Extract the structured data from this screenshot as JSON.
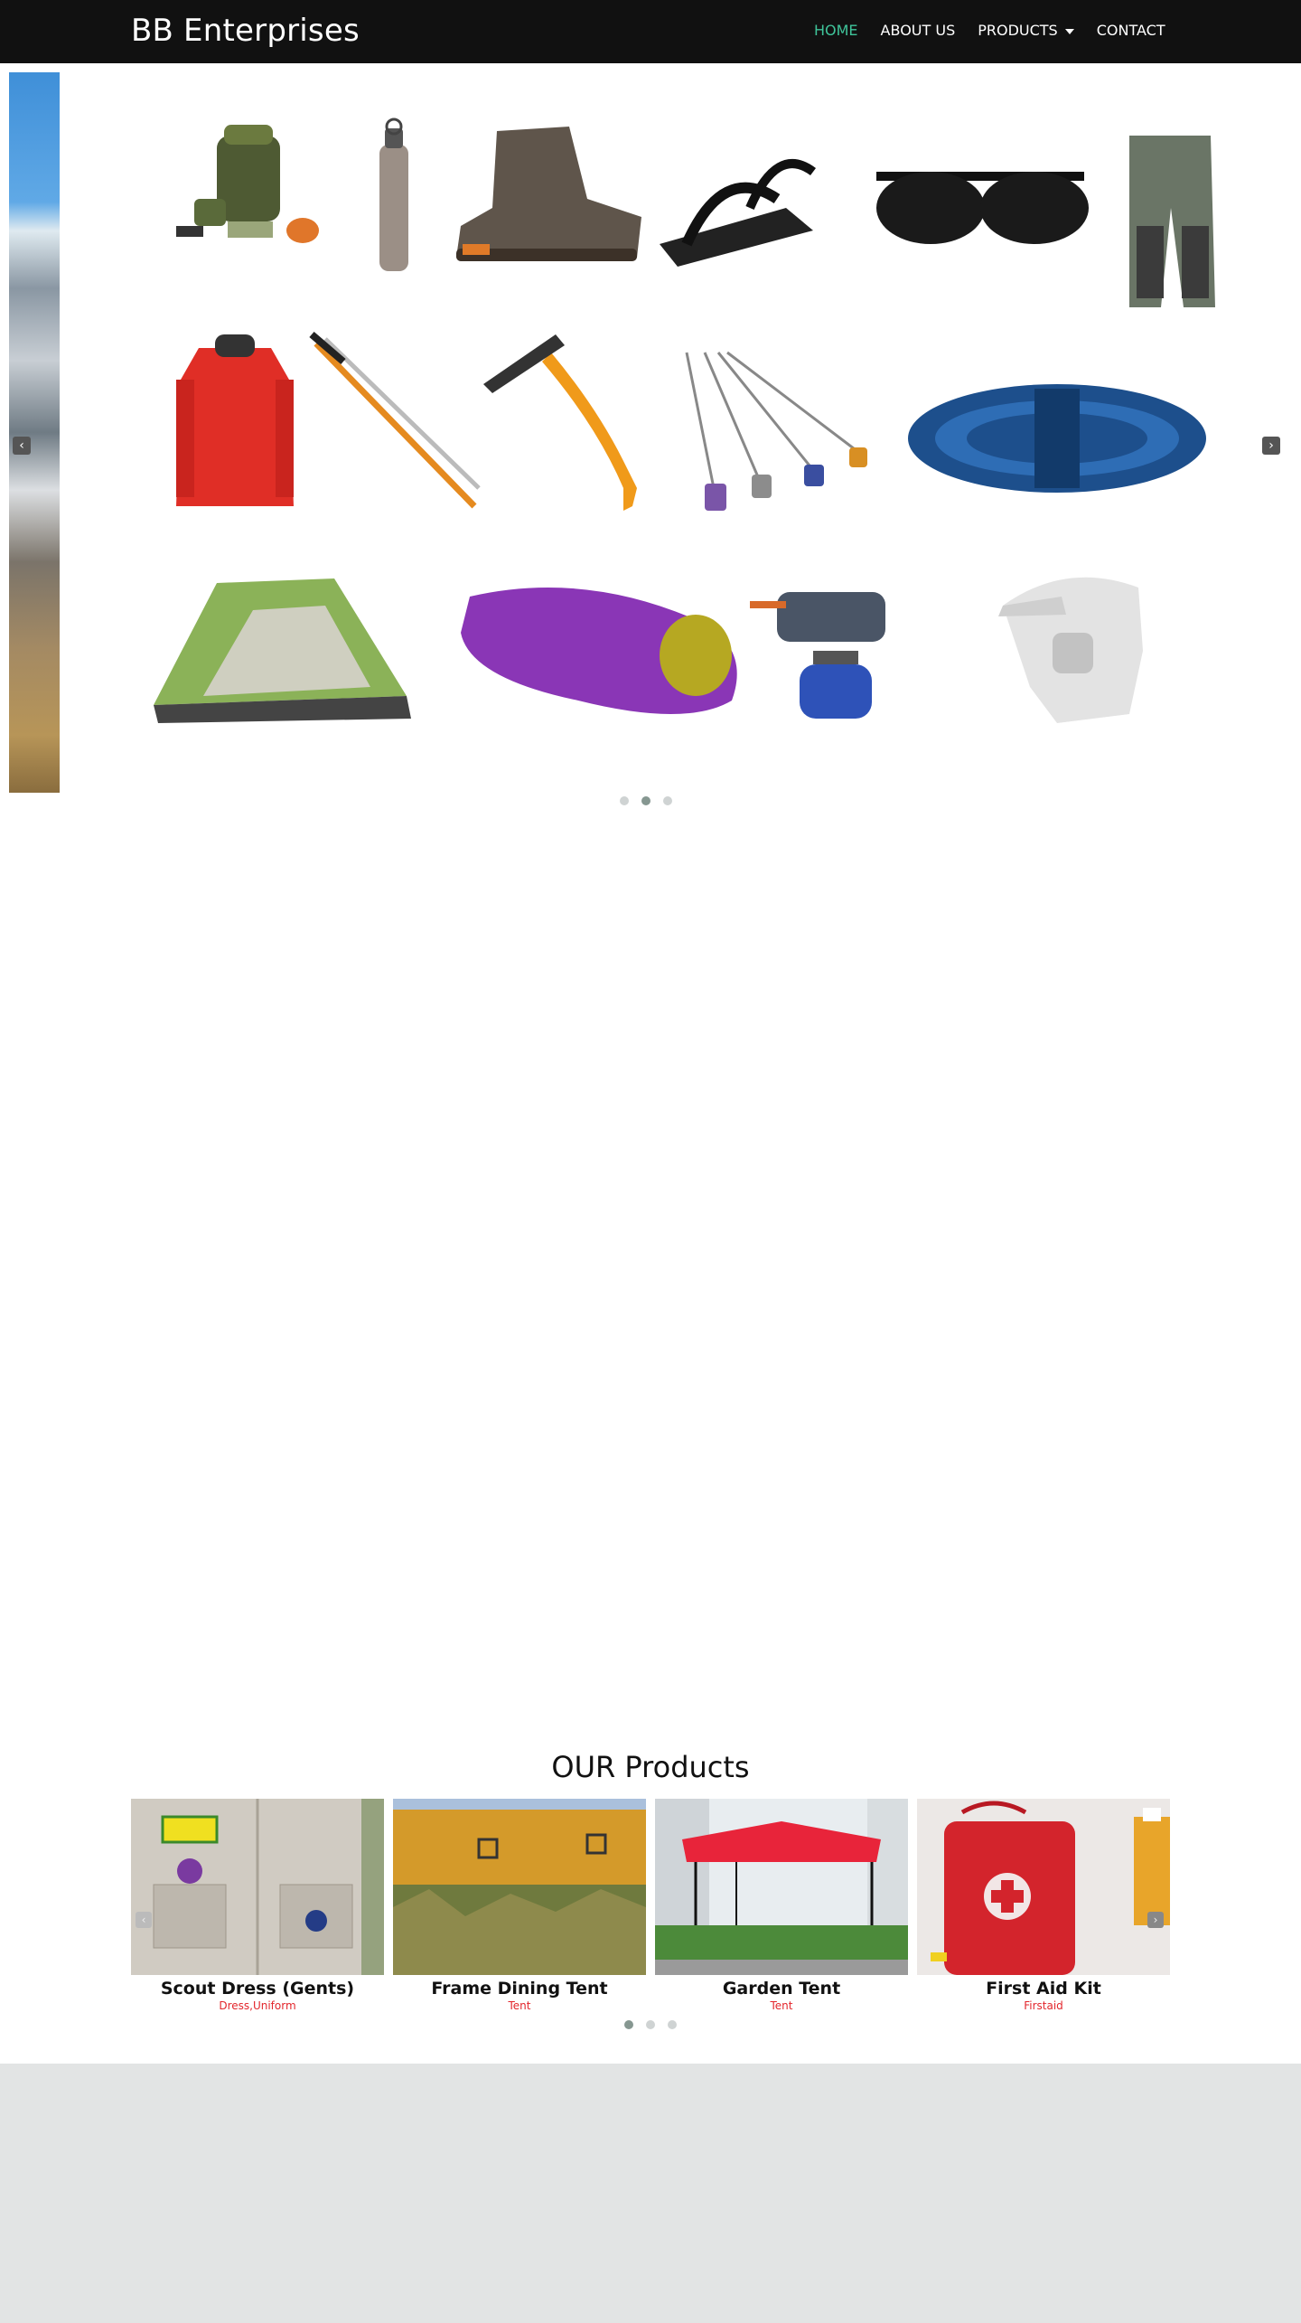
{
  "header": {
    "brand": "BB Enterprises",
    "nav": [
      {
        "label": "HOME",
        "active": true
      },
      {
        "label": "ABOUT US",
        "active": false
      },
      {
        "label": "PRODUCTS",
        "active": false,
        "dropdown": true
      },
      {
        "label": "CONTACT",
        "active": false
      }
    ],
    "active_color": "#3fc49a"
  },
  "hero": {
    "prev_icon": "‹",
    "next_icon": "›",
    "dots": 3,
    "active_dot": 2
  },
  "products": {
    "heading": "OUR Products",
    "prev_icon": "‹",
    "next_icon": "›",
    "dots": 3,
    "active_dot": 1,
    "items": [
      {
        "title": "Scout Dress (Gents)",
        "category": "Dress,Uniform",
        "icon": "scout-dress"
      },
      {
        "title": "Frame Dining Tent",
        "category": "Tent",
        "icon": "frame-tent"
      },
      {
        "title": "Garden Tent",
        "category": "Tent",
        "icon": "garden-tent"
      },
      {
        "title": "First Aid Kit",
        "category": "Firstaid",
        "icon": "first-aid-kit"
      }
    ]
  },
  "colors": {
    "navbar": "#111111",
    "category": "#e3262c",
    "footer": "#e2e4e4"
  }
}
